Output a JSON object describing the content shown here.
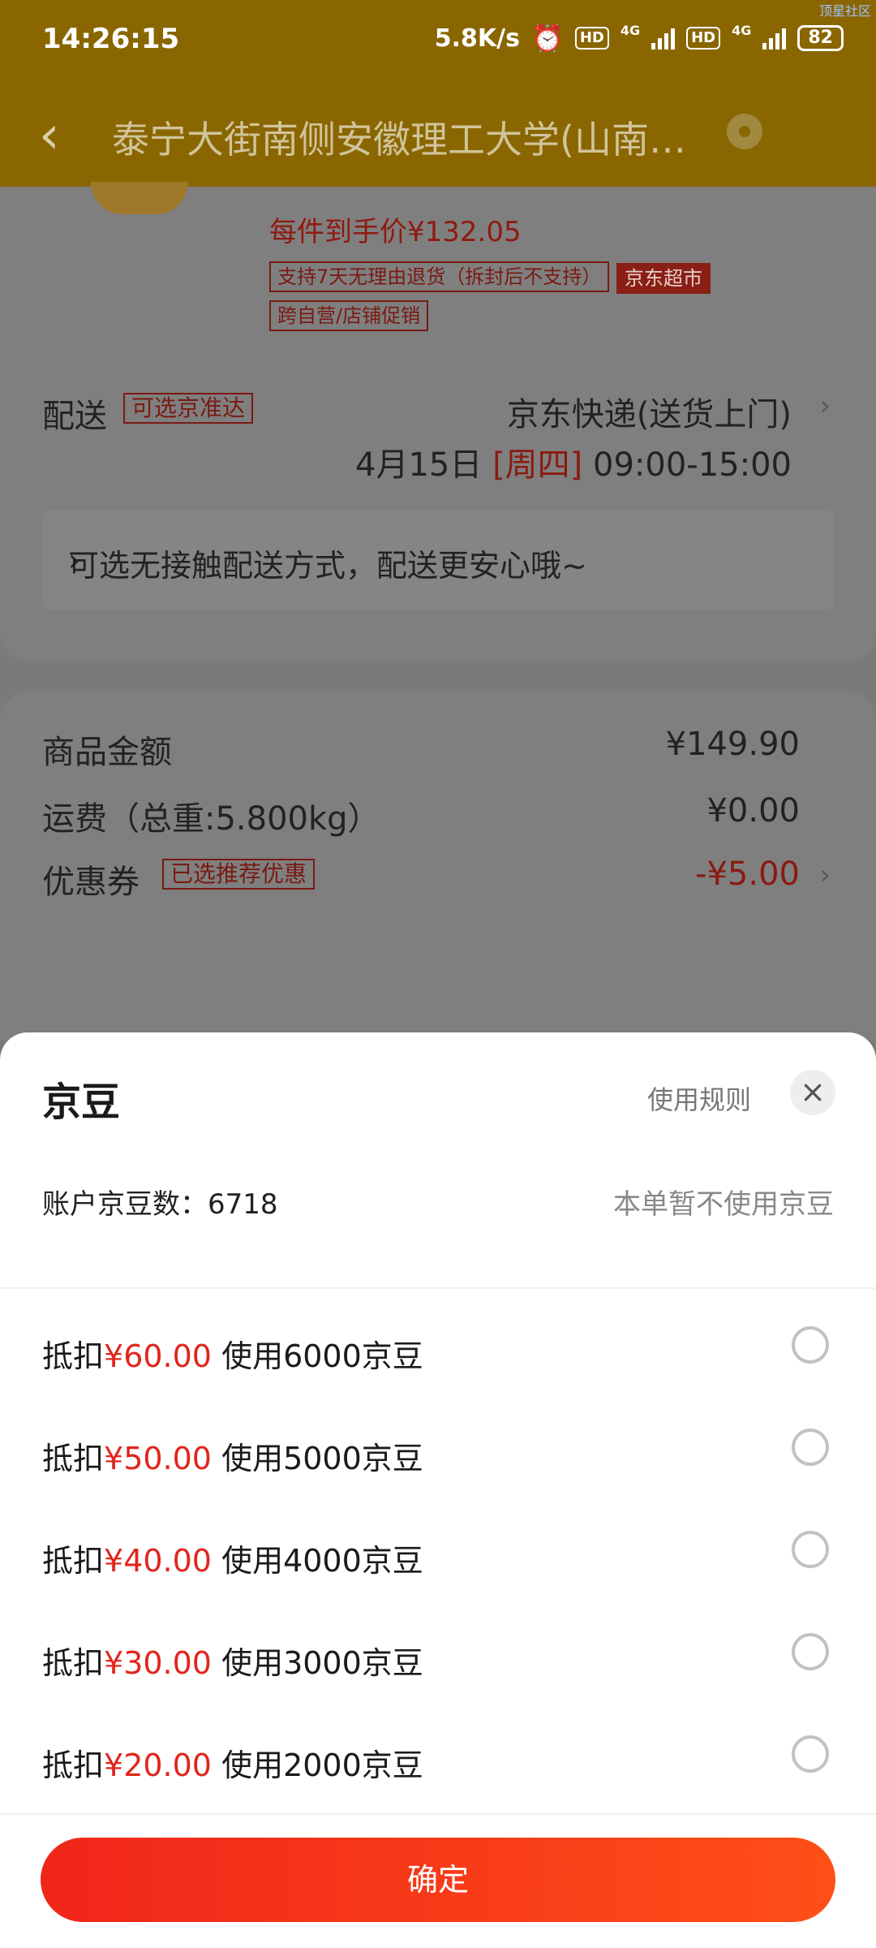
{
  "status_bar": {
    "time": "14:26:15",
    "speed": "5.8K/s",
    "hd1": "HD",
    "net1": "4G",
    "hd2": "HD",
    "net2": "4G",
    "battery": "82",
    "watermark": "顶星社区"
  },
  "header": {
    "address": "泰宁大街南侧安徽理工大学(山南…"
  },
  "product": {
    "unit_price": "每件到手价¥132.05",
    "tags": [
      "支持7天无理由退货（拆封后不支持）",
      "京东超市",
      "跨自营/店铺促销"
    ]
  },
  "delivery": {
    "label": "配送",
    "badge": "可选京准达",
    "method": "京东快递(送货上门)",
    "date": "4月15日",
    "weekday": "[周四]",
    "time_range": "09:00-15:00",
    "no_contact": "可选无接触配送方式，配送更安心哦~"
  },
  "summary": {
    "goods_label": "商品金额",
    "goods_value": "¥149.90",
    "freight_label": "运费（总重:5.800kg）",
    "freight_value": "¥0.00",
    "coupon_label": "优惠券",
    "coupon_badge": "已选推荐优惠",
    "coupon_value": "-¥5.00"
  },
  "sheet": {
    "title": "京豆",
    "rules": "使用规则",
    "account_label": "账户京豆数：",
    "account_value": "6718",
    "not_use": "本单暂不使用京豆",
    "options": [
      {
        "prefix": "抵扣",
        "amount": "¥60.00",
        "suffix": " 使用6000京豆",
        "selected": false
      },
      {
        "prefix": "抵扣",
        "amount": "¥50.00",
        "suffix": " 使用5000京豆",
        "selected": false
      },
      {
        "prefix": "抵扣",
        "amount": "¥40.00",
        "suffix": " 使用4000京豆",
        "selected": false
      },
      {
        "prefix": "抵扣",
        "amount": "¥30.00",
        "suffix": " 使用3000京豆",
        "selected": false
      },
      {
        "prefix": "抵扣",
        "amount": "¥20.00",
        "suffix": " 使用2000京豆",
        "selected": false
      }
    ],
    "confirm": "确定"
  },
  "colors": {
    "accent": "#e1251b",
    "header_bg": "#8a6600",
    "overlay": "#7f7f7f"
  }
}
